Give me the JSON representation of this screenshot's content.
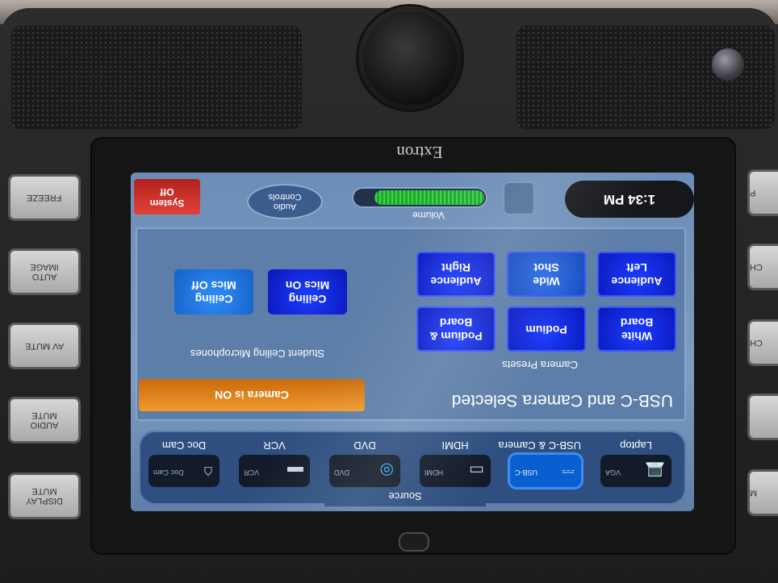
{
  "device": {
    "brand": "Extron",
    "left_buttons": [
      "FREEZE",
      "AUTO IMAGE",
      "AV MUTE",
      "AUDIO MUTE",
      "DISPLAY MUTE"
    ],
    "right_buttons": [
      "P",
      "CH",
      "CH",
      "",
      "M"
    ]
  },
  "header": {
    "time": "1:34 PM",
    "volume_label": "Volume",
    "volume_level": 0.85,
    "audio_controls": "Audio Controls",
    "system_off": "System Off"
  },
  "main": {
    "title": "USB-C and Camera Selected",
    "status": "Camera is ON",
    "camera_presets_label": "Camera Presets",
    "camera_presets": [
      [
        "White Board",
        "Podium",
        "Podium & Board"
      ],
      [
        "Audience Left",
        "Wide Shot",
        "Audience Right"
      ]
    ],
    "mics_label": "Student Ceiling Microphones",
    "mic_on": "Ceiling Mics On",
    "mic_off": "Ceiling Mics Off"
  },
  "source": {
    "title": "Source",
    "items": [
      {
        "name": "Laptop",
        "icon_label": "VGA",
        "icon": "laptop-icon"
      },
      {
        "name": "USB-C & Camera",
        "icon_label": "USB-C",
        "icon": "usb-icon"
      },
      {
        "name": "HDMI",
        "icon_label": "HDMI",
        "icon": "hdmi-icon"
      },
      {
        "name": "DVD",
        "icon_label": "DVD",
        "icon": "disc-icon"
      },
      {
        "name": "VCR",
        "icon_label": "VCR",
        "icon": "tape-icon"
      },
      {
        "name": "Doc Cam",
        "icon_label": "Doc Cam",
        "icon": "doc-camera-icon"
      }
    ],
    "selected": 1
  },
  "colors": {
    "accent_blue": "#0a17b8",
    "status_orange": "#e38a22",
    "system_off_red": "#c4271f",
    "volume_green": "#3fd24c"
  }
}
